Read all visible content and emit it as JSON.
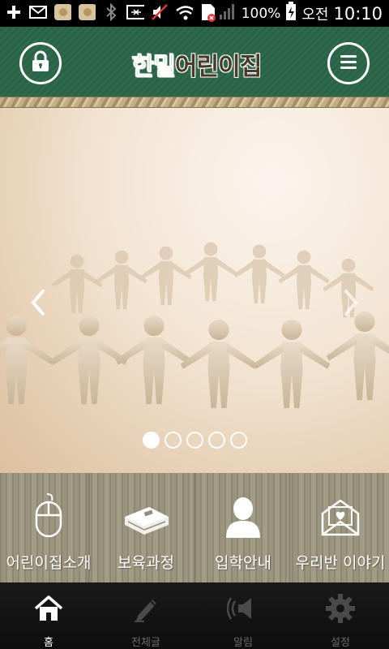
{
  "status_bar": {
    "icons": [
      "plus-icon",
      "mail-icon",
      "app-icon",
      "app-icon",
      "bluetooth-icon",
      "nfc-icon",
      "mute-icon",
      "wifi-icon",
      "sim-error-icon",
      "signal-icon",
      "battery-charging-icon"
    ],
    "battery_percent": "100%",
    "ampm": "오전",
    "time": "10:10"
  },
  "header": {
    "logo_part1": "한밀",
    "logo_part2": "어린이집",
    "lock_icon": "lock-icon",
    "menu_icon": "hamburger-menu-icon",
    "color": "#2c6448"
  },
  "banner": {
    "slide_count": 5,
    "active_slide": 1,
    "prev_icon": "chevron-left-icon",
    "next_icon": "chevron-right-icon"
  },
  "quick_menu": [
    {
      "label": "어린이집소개",
      "icon": "mouse-icon"
    },
    {
      "label": "보육과정",
      "icon": "book-icon"
    },
    {
      "label": "입학안내",
      "icon": "person-icon"
    },
    {
      "label": "우리반 이야기",
      "icon": "heart-envelope-icon"
    }
  ],
  "bottom_nav": [
    {
      "label": "홈",
      "icon": "home-icon",
      "active": true
    },
    {
      "label": "전체글",
      "icon": "pencil-icon",
      "active": false
    },
    {
      "label": "알림",
      "icon": "speaker-icon",
      "active": false
    },
    {
      "label": "설정",
      "icon": "gear-icon",
      "active": false
    }
  ]
}
